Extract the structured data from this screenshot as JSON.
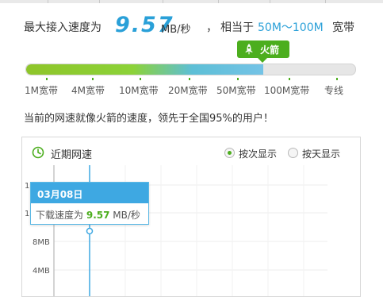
{
  "header": {
    "prefix": "最大接入速度为",
    "speed_value": "9.57",
    "speed_unit": "MB/秒",
    "separator": "，",
    "relation": "相当于",
    "equivalent_range": "50M～100M",
    "bandwidth_word": "宽带"
  },
  "level_tag": {
    "icon": "rocket-icon",
    "label": "火箭"
  },
  "progress": {
    "fill_fraction": 0.72,
    "scale_labels": [
      "1M宽带",
      "4M宽带",
      "10M宽带",
      "20M宽带",
      "50M宽带",
      "100M宽带",
      "专线"
    ]
  },
  "comparison_text": "当前的网速就像火箭的速度，领先于全国95%的用户！",
  "recent_panel": {
    "icon": "clock-icon",
    "title": "近期网速",
    "options": [
      {
        "label": "按次显示",
        "selected": true
      },
      {
        "label": "按天显示",
        "selected": false
      }
    ],
    "y_ticks": [
      "12MB",
      "10MB",
      "8MB",
      "4MB"
    ],
    "tooltip": {
      "date": "03月08日",
      "label": "下载速度为",
      "value": "9.57",
      "unit": "MB/秒"
    }
  },
  "chart_data": {
    "type": "line",
    "title": "近期网速",
    "y_tick_labels": [
      "12MB",
      "10MB",
      "8MB",
      "4MB"
    ],
    "series": [
      {
        "values": [
          9.57
        ]
      }
    ],
    "categories": [
      "03月08日"
    ]
  },
  "colors": {
    "accent_blue": "#2aa0d8",
    "accent_green": "#4cae1e",
    "tooltip_header": "#3ea8e2"
  }
}
